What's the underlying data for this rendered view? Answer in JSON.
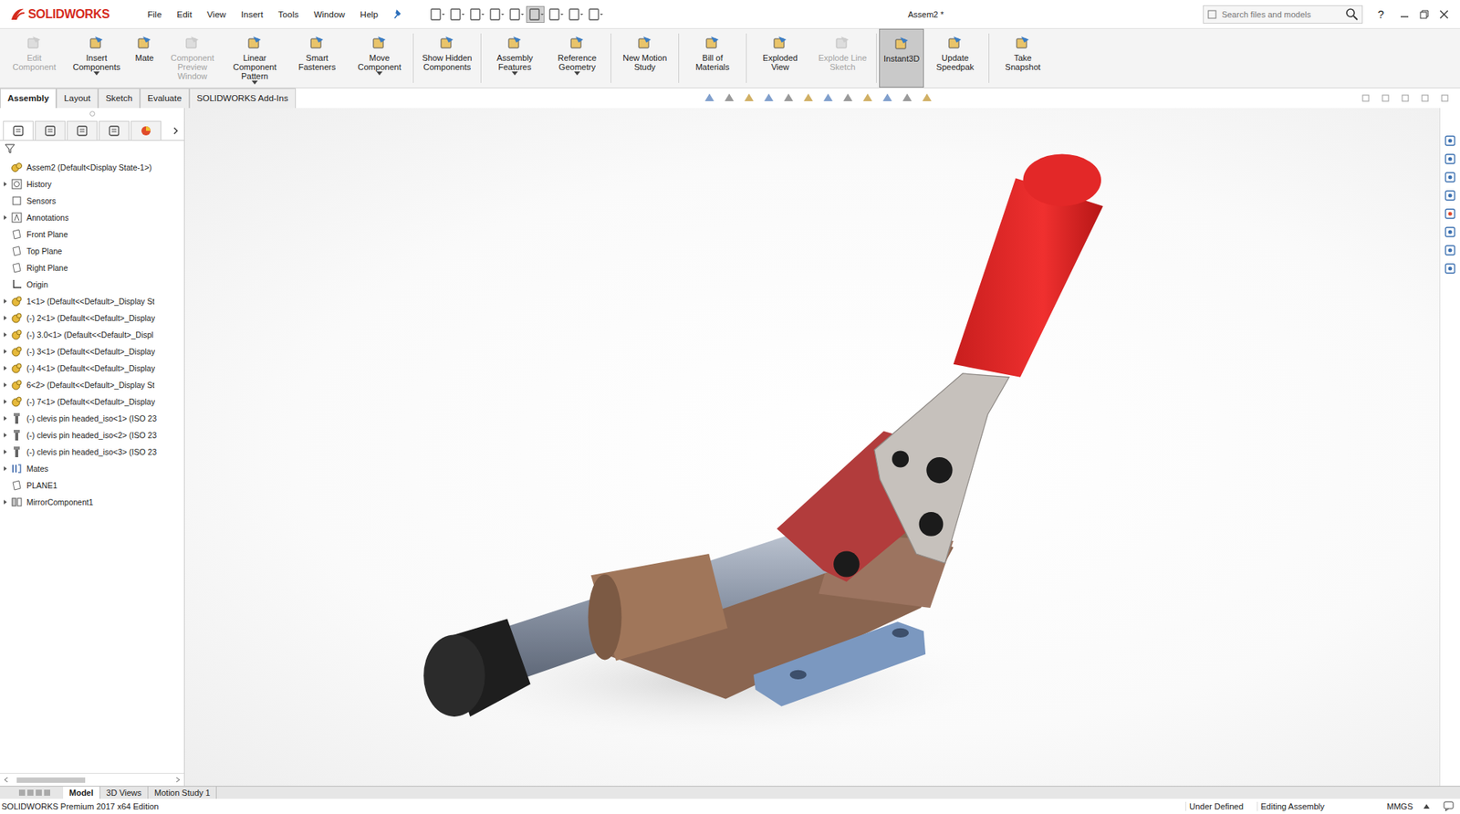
{
  "window": {
    "app_name": "SOLIDWORKS",
    "title": "Assem2 *",
    "help": "?"
  },
  "menu": [
    "File",
    "Edit",
    "View",
    "Insert",
    "Tools",
    "Window",
    "Help"
  ],
  "search": {
    "placeholder": "Search files and models"
  },
  "ribbon": [
    {
      "label": "Edit Component",
      "disabled": true,
      "selected": false,
      "dropdown": false,
      "separator": false
    },
    {
      "label": "Insert Components",
      "disabled": false,
      "selected": false,
      "dropdown": true,
      "separator": false
    },
    {
      "label": "Mate",
      "disabled": false,
      "selected": false,
      "dropdown": false,
      "separator": false
    },
    {
      "label": "Component Preview Window",
      "disabled": true,
      "selected": false,
      "dropdown": false,
      "separator": false
    },
    {
      "label": "Linear Component Pattern",
      "disabled": false,
      "selected": false,
      "dropdown": true,
      "separator": false
    },
    {
      "label": "Smart Fasteners",
      "disabled": false,
      "selected": false,
      "dropdown": false,
      "separator": false
    },
    {
      "label": "Move Component",
      "disabled": false,
      "selected": false,
      "dropdown": true,
      "separator": false
    },
    {
      "label": "Show Hidden Components",
      "disabled": false,
      "selected": false,
      "dropdown": false,
      "separator": true
    },
    {
      "label": "Assembly Features",
      "disabled": false,
      "selected": false,
      "dropdown": true,
      "separator": true
    },
    {
      "label": "Reference Geometry",
      "disabled": false,
      "selected": false,
      "dropdown": true,
      "separator": false
    },
    {
      "label": "New Motion Study",
      "disabled": false,
      "selected": false,
      "dropdown": false,
      "separator": true
    },
    {
      "label": "Bill of Materials",
      "disabled": false,
      "selected": false,
      "dropdown": false,
      "separator": true
    },
    {
      "label": "Exploded View",
      "disabled": false,
      "selected": false,
      "dropdown": false,
      "separator": true
    },
    {
      "label": "Explode Line Sketch",
      "disabled": true,
      "selected": false,
      "dropdown": false,
      "separator": false
    },
    {
      "label": "Instant3D",
      "disabled": false,
      "selected": true,
      "dropdown": false,
      "separator": true
    },
    {
      "label": "Update Speedpak",
      "disabled": false,
      "selected": false,
      "dropdown": false,
      "separator": false
    },
    {
      "label": "Take Snapshot",
      "disabled": false,
      "selected": false,
      "dropdown": false,
      "separator": true
    }
  ],
  "command_tabs": [
    {
      "label": "Assembly",
      "selected": true
    },
    {
      "label": "Layout",
      "selected": false
    },
    {
      "label": "Sketch",
      "selected": false
    },
    {
      "label": "Evaluate",
      "selected": false
    },
    {
      "label": "SOLIDWORKS Add-Ins",
      "selected": false
    }
  ],
  "tree": {
    "root": "Assem2  (Default<Display State-1>)",
    "items": [
      {
        "label": "History",
        "kind": "history",
        "expandable": true
      },
      {
        "label": "Sensors",
        "kind": "sensors",
        "expandable": false
      },
      {
        "label": "Annotations",
        "kind": "annotations",
        "expandable": true
      },
      {
        "label": "Front Plane",
        "kind": "plane",
        "expandable": false
      },
      {
        "label": "Top Plane",
        "kind": "plane",
        "expandable": false
      },
      {
        "label": "Right Plane",
        "kind": "plane",
        "expandable": false
      },
      {
        "label": "Origin",
        "kind": "origin",
        "expandable": false
      },
      {
        "label": "1<1> (Default<<Default>_Display St",
        "kind": "part",
        "expandable": true
      },
      {
        "label": "(-) 2<1> (Default<<Default>_Display",
        "kind": "part",
        "expandable": true
      },
      {
        "label": "(-) 3.0<1> (Default<<Default>_Displ",
        "kind": "part",
        "expandable": true
      },
      {
        "label": "(-) 3<1> (Default<<Default>_Display",
        "kind": "part",
        "expandable": true
      },
      {
        "label": "(-) 4<1> (Default<<Default>_Display",
        "kind": "part",
        "expandable": true
      },
      {
        "label": "6<2> (Default<<Default>_Display St",
        "kind": "part",
        "expandable": true
      },
      {
        "label": "(-) 7<1> (Default<<Default>_Display",
        "kind": "part",
        "expandable": true
      },
      {
        "label": "(-) clevis pin headed_iso<1> (ISO 23",
        "kind": "fastener",
        "expandable": true
      },
      {
        "label": "(-) clevis pin headed_iso<2> (ISO 23",
        "kind": "fastener",
        "expandable": true
      },
      {
        "label": "(-) clevis pin headed_iso<3> (ISO 23",
        "kind": "fastener",
        "expandable": true
      },
      {
        "label": "Mates",
        "kind": "mates",
        "expandable": true
      },
      {
        "label": "PLANE1",
        "kind": "plane",
        "expandable": false
      },
      {
        "label": "MirrorComponent1",
        "kind": "mirror",
        "expandable": true
      }
    ]
  },
  "bottom_tabs": [
    {
      "label": "Model",
      "selected": true
    },
    {
      "label": "3D Views",
      "selected": false
    },
    {
      "label": "Motion Study 1",
      "selected": false
    }
  ],
  "status_bar": {
    "edition": "SOLIDWORKS Premium 2017 x64 Edition",
    "state": "Under Defined",
    "mode": "Editing Assembly",
    "units": "MMGS"
  }
}
